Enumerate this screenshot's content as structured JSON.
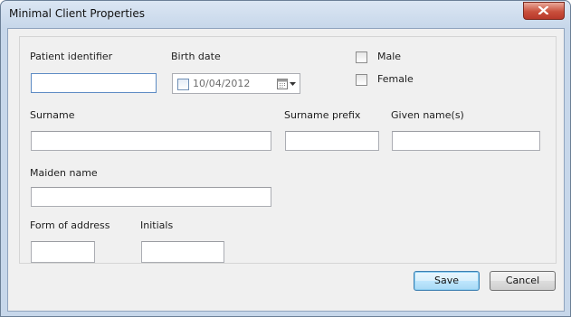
{
  "window": {
    "title": "Minimal Client Properties",
    "close_icon": "close-icon"
  },
  "form": {
    "patient_identifier": {
      "label": "Patient identifier",
      "value": ""
    },
    "birth_date": {
      "label": "Birth date",
      "value": "10/04/2012",
      "checked": false,
      "icon": "calendar-icon"
    },
    "gender": {
      "male_label": "Male",
      "male_checked": false,
      "female_label": "Female",
      "female_checked": false
    },
    "surname": {
      "label": "Surname",
      "value": ""
    },
    "surname_prefix": {
      "label": "Surname prefix",
      "value": ""
    },
    "given_names": {
      "label": "Given name(s)",
      "value": ""
    },
    "maiden_name": {
      "label": "Maiden name",
      "value": ""
    },
    "form_of_address": {
      "label": "Form of address",
      "value": ""
    },
    "initials": {
      "label": "Initials",
      "value": ""
    }
  },
  "buttons": {
    "save_label": "Save",
    "cancel_label": "Cancel"
  },
  "colors": {
    "title_bar": "#c7d7ea",
    "close_button": "#c9503c",
    "default_button_border": "#3c7fb1",
    "dialog_background": "#f0f0f0"
  }
}
